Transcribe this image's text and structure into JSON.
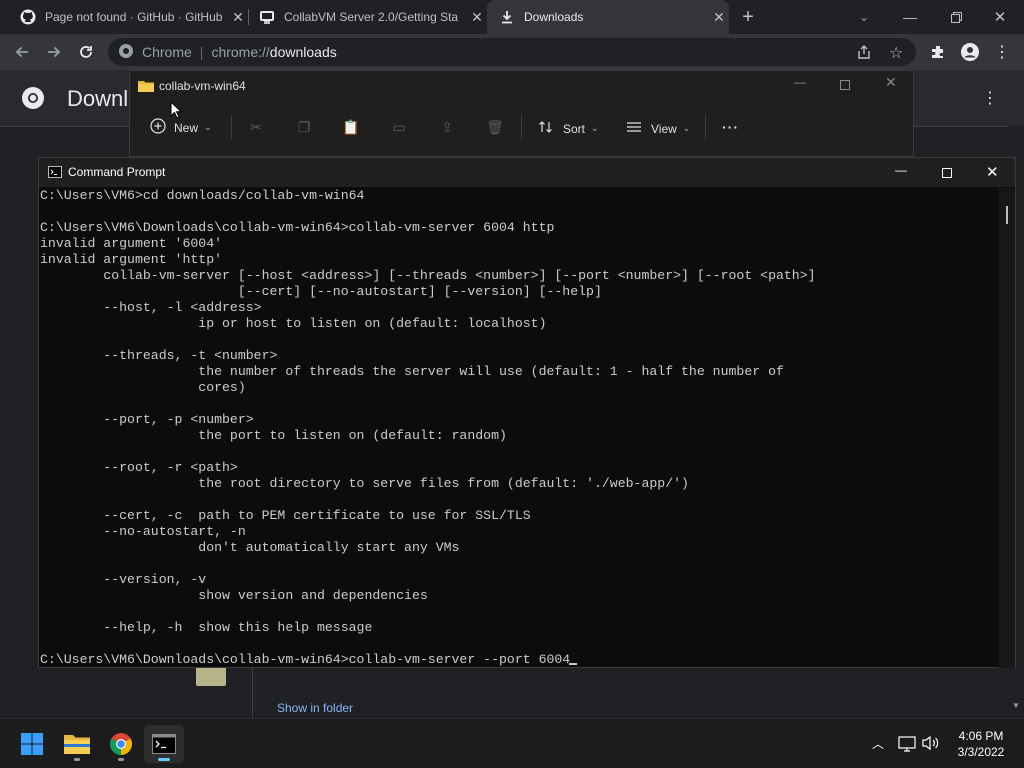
{
  "tabs": [
    {
      "title": "Page not found · GitHub · GitHub",
      "icon": "github-icon"
    },
    {
      "title": "CollabVM Server 2.0/Getting Sta",
      "icon": "collabvm-icon"
    },
    {
      "title": "Downloads",
      "icon": "download-icon"
    }
  ],
  "browser": {
    "site_label": "Chrome",
    "url_prefix": "chrome://",
    "url_path": "downloads"
  },
  "downloads_page": {
    "title": "Downl",
    "show_in_folder": "Show in folder"
  },
  "explorer": {
    "title": "collab-vm-win64",
    "new_label": "New",
    "sort_label": "Sort",
    "view_label": "View",
    "more_label": "···"
  },
  "cmd": {
    "title": "Command Prompt",
    "console_lines": [
      "C:\\Users\\VM6>cd downloads/collab-vm-win64",
      "",
      "C:\\Users\\VM6\\Downloads\\collab-vm-win64>collab-vm-server 6004 http",
      "invalid argument '6004'",
      "invalid argument 'http'",
      "        collab-vm-server [--host <address>] [--threads <number>] [--port <number>] [--root <path>]",
      "                         [--cert] [--no-autostart] [--version] [--help]",
      "        --host, -l <address>",
      "                    ip or host to listen on (default: localhost)",
      "",
      "        --threads, -t <number>",
      "                    the number of threads the server will use (default: 1 - half the number of",
      "                    cores)",
      "",
      "        --port, -p <number>",
      "                    the port to listen on (default: random)",
      "",
      "        --root, -r <path>",
      "                    the root directory to serve files from (default: './web-app/')",
      "",
      "        --cert, -c  path to PEM certificate to use for SSL/TLS",
      "        --no-autostart, -n",
      "                    don't automatically start any VMs",
      "",
      "        --version, -v",
      "                    show version and dependencies",
      "",
      "        --help, -h  show this help message",
      "",
      "C:\\Users\\VM6\\Downloads\\collab-vm-win64>collab-vm-server --port 6004"
    ]
  },
  "taskbar": {
    "time": "4:06 PM",
    "date": "3/3/2022"
  },
  "colors": {
    "chrome_frame": "#202124",
    "chrome_toolbar": "#35363a",
    "console_bg": "#0c0c0c",
    "console_text": "#cccccc",
    "taskbar_bg": "#1c1c1c",
    "link": "#8ab4f8"
  }
}
